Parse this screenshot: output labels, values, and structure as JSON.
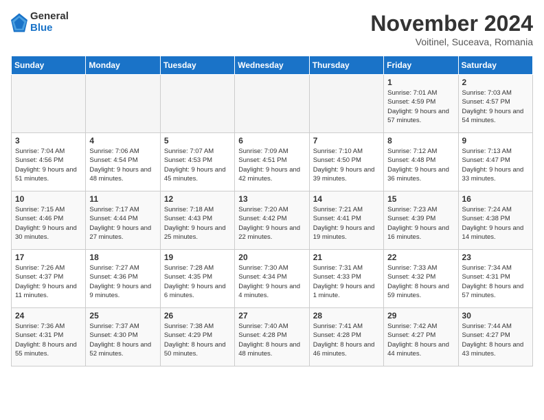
{
  "logo": {
    "general": "General",
    "blue": "Blue"
  },
  "title": "November 2024",
  "subtitle": "Voitinel, Suceava, Romania",
  "weekdays": [
    "Sunday",
    "Monday",
    "Tuesday",
    "Wednesday",
    "Thursday",
    "Friday",
    "Saturday"
  ],
  "weeks": [
    [
      {
        "day": "",
        "info": ""
      },
      {
        "day": "",
        "info": ""
      },
      {
        "day": "",
        "info": ""
      },
      {
        "day": "",
        "info": ""
      },
      {
        "day": "",
        "info": ""
      },
      {
        "day": "1",
        "info": "Sunrise: 7:01 AM\nSunset: 4:59 PM\nDaylight: 9 hours and 57 minutes."
      },
      {
        "day": "2",
        "info": "Sunrise: 7:03 AM\nSunset: 4:57 PM\nDaylight: 9 hours and 54 minutes."
      }
    ],
    [
      {
        "day": "3",
        "info": "Sunrise: 7:04 AM\nSunset: 4:56 PM\nDaylight: 9 hours and 51 minutes."
      },
      {
        "day": "4",
        "info": "Sunrise: 7:06 AM\nSunset: 4:54 PM\nDaylight: 9 hours and 48 minutes."
      },
      {
        "day": "5",
        "info": "Sunrise: 7:07 AM\nSunset: 4:53 PM\nDaylight: 9 hours and 45 minutes."
      },
      {
        "day": "6",
        "info": "Sunrise: 7:09 AM\nSunset: 4:51 PM\nDaylight: 9 hours and 42 minutes."
      },
      {
        "day": "7",
        "info": "Sunrise: 7:10 AM\nSunset: 4:50 PM\nDaylight: 9 hours and 39 minutes."
      },
      {
        "day": "8",
        "info": "Sunrise: 7:12 AM\nSunset: 4:48 PM\nDaylight: 9 hours and 36 minutes."
      },
      {
        "day": "9",
        "info": "Sunrise: 7:13 AM\nSunset: 4:47 PM\nDaylight: 9 hours and 33 minutes."
      }
    ],
    [
      {
        "day": "10",
        "info": "Sunrise: 7:15 AM\nSunset: 4:46 PM\nDaylight: 9 hours and 30 minutes."
      },
      {
        "day": "11",
        "info": "Sunrise: 7:17 AM\nSunset: 4:44 PM\nDaylight: 9 hours and 27 minutes."
      },
      {
        "day": "12",
        "info": "Sunrise: 7:18 AM\nSunset: 4:43 PM\nDaylight: 9 hours and 25 minutes."
      },
      {
        "day": "13",
        "info": "Sunrise: 7:20 AM\nSunset: 4:42 PM\nDaylight: 9 hours and 22 minutes."
      },
      {
        "day": "14",
        "info": "Sunrise: 7:21 AM\nSunset: 4:41 PM\nDaylight: 9 hours and 19 minutes."
      },
      {
        "day": "15",
        "info": "Sunrise: 7:23 AM\nSunset: 4:39 PM\nDaylight: 9 hours and 16 minutes."
      },
      {
        "day": "16",
        "info": "Sunrise: 7:24 AM\nSunset: 4:38 PM\nDaylight: 9 hours and 14 minutes."
      }
    ],
    [
      {
        "day": "17",
        "info": "Sunrise: 7:26 AM\nSunset: 4:37 PM\nDaylight: 9 hours and 11 minutes."
      },
      {
        "day": "18",
        "info": "Sunrise: 7:27 AM\nSunset: 4:36 PM\nDaylight: 9 hours and 9 minutes."
      },
      {
        "day": "19",
        "info": "Sunrise: 7:28 AM\nSunset: 4:35 PM\nDaylight: 9 hours and 6 minutes."
      },
      {
        "day": "20",
        "info": "Sunrise: 7:30 AM\nSunset: 4:34 PM\nDaylight: 9 hours and 4 minutes."
      },
      {
        "day": "21",
        "info": "Sunrise: 7:31 AM\nSunset: 4:33 PM\nDaylight: 9 hours and 1 minute."
      },
      {
        "day": "22",
        "info": "Sunrise: 7:33 AM\nSunset: 4:32 PM\nDaylight: 8 hours and 59 minutes."
      },
      {
        "day": "23",
        "info": "Sunrise: 7:34 AM\nSunset: 4:31 PM\nDaylight: 8 hours and 57 minutes."
      }
    ],
    [
      {
        "day": "24",
        "info": "Sunrise: 7:36 AM\nSunset: 4:31 PM\nDaylight: 8 hours and 55 minutes."
      },
      {
        "day": "25",
        "info": "Sunrise: 7:37 AM\nSunset: 4:30 PM\nDaylight: 8 hours and 52 minutes."
      },
      {
        "day": "26",
        "info": "Sunrise: 7:38 AM\nSunset: 4:29 PM\nDaylight: 8 hours and 50 minutes."
      },
      {
        "day": "27",
        "info": "Sunrise: 7:40 AM\nSunset: 4:28 PM\nDaylight: 8 hours and 48 minutes."
      },
      {
        "day": "28",
        "info": "Sunrise: 7:41 AM\nSunset: 4:28 PM\nDaylight: 8 hours and 46 minutes."
      },
      {
        "day": "29",
        "info": "Sunrise: 7:42 AM\nSunset: 4:27 PM\nDaylight: 8 hours and 44 minutes."
      },
      {
        "day": "30",
        "info": "Sunrise: 7:44 AM\nSunset: 4:27 PM\nDaylight: 8 hours and 43 minutes."
      }
    ]
  ]
}
